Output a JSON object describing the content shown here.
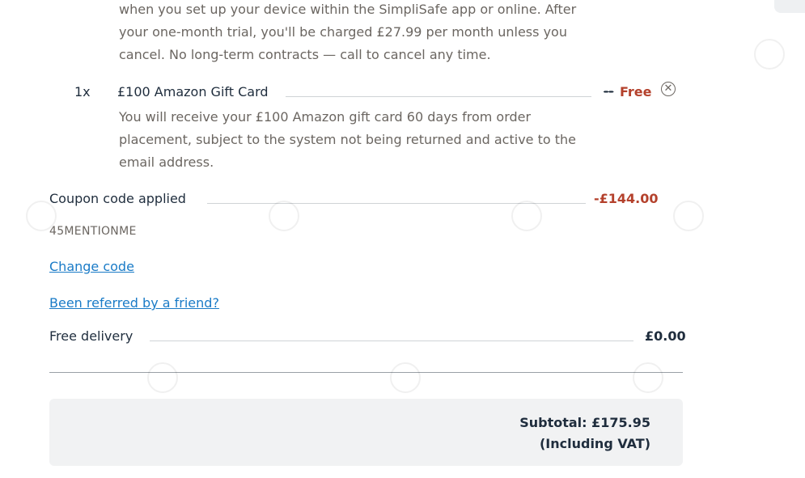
{
  "intro": {
    "lines": [
      "when you set up your device within the SimpliSafe app or online. After",
      "your one-month trial, you'll be charged £27.99 per month unless you",
      "cancel. No long-term contracts — call to cancel any time."
    ]
  },
  "gift_card": {
    "quantity": "1x",
    "name": "£100 Amazon Gift Card",
    "original_price": "--",
    "price": "Free",
    "remove_icon": "close-circle-icon",
    "description_lines": [
      "You will receive your £100 Amazon gift card 60 days from order",
      "placement, subject to the system not being returned and active to the",
      "email address."
    ]
  },
  "coupon": {
    "label": "Coupon code applied",
    "amount": "-£144.00",
    "code": "45MENTIONME",
    "change_link": "Change code"
  },
  "referral_link": "Been referred by a friend?",
  "delivery": {
    "label": "Free delivery",
    "price": "£0.00"
  },
  "subtotal": {
    "line1": "Subtotal: £175.95",
    "line2": "(Including VAT)"
  },
  "colors": {
    "accent_price": "#b4412c",
    "link": "#1a7bc7",
    "text": "#1f2d3d",
    "muted": "#6b6661"
  }
}
